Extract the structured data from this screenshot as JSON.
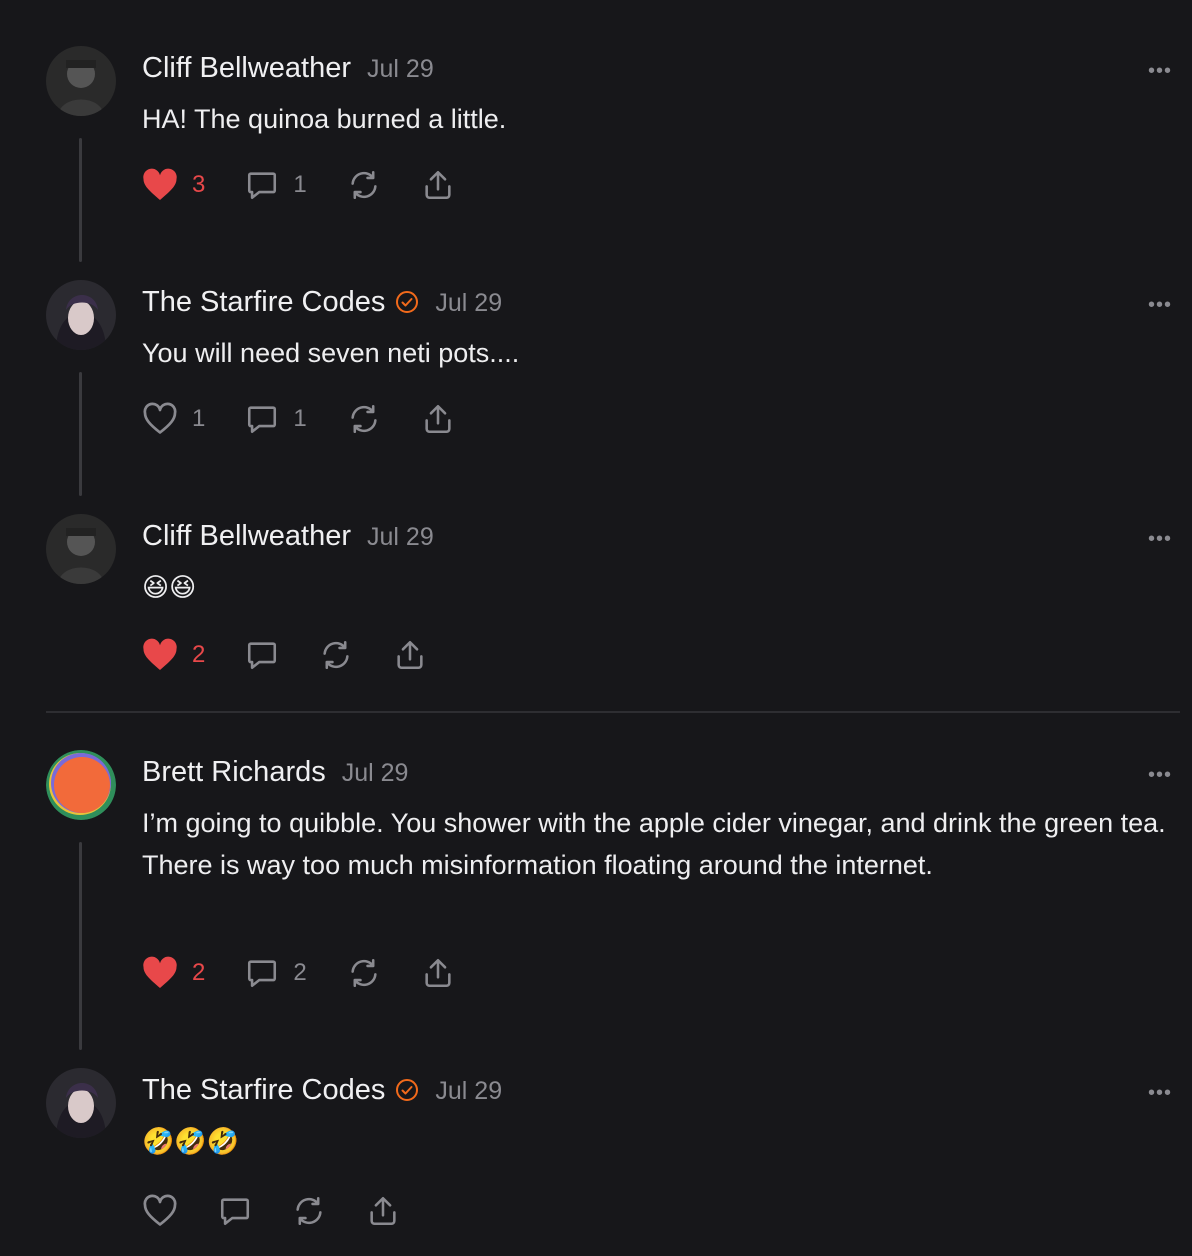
{
  "posts": [
    {
      "author": "Cliff Bellweather",
      "verified": false,
      "date": "Jul 29",
      "text": "HA! The quinoa burned a little.",
      "likes": "3",
      "liked": true,
      "replies": "1",
      "avatar": "cliff-avatar"
    },
    {
      "author": "The Starfire Codes",
      "verified": true,
      "date": "Jul 29",
      "text": "You will need seven neti pots....",
      "likes": "1",
      "liked": false,
      "replies": "1",
      "avatar": "starfire-avatar"
    },
    {
      "author": "Cliff Bellweather",
      "verified": false,
      "date": "Jul 29",
      "text": "😆😆",
      "likes": "2",
      "liked": true,
      "replies": "",
      "avatar": "cliff-avatar"
    },
    {
      "author": "Brett Richards",
      "verified": false,
      "date": "Jul 29",
      "text": "I’m going to quibble. You shower with the apple cider vinegar, and drink the green tea. There is way too much misinformation floating around the internet.",
      "likes": "2",
      "liked": true,
      "replies": "2",
      "avatar": "brett-avatar"
    },
    {
      "author": "The Starfire Codes",
      "verified": true,
      "date": "Jul 29",
      "text": "🤣🤣🤣",
      "likes": "",
      "liked": false,
      "replies": "",
      "avatar": "starfire-avatar"
    }
  ],
  "more_label": "•••",
  "colors": {
    "background": "#17171a",
    "like_red": "#e8484a",
    "verified_orange": "#f26a1b",
    "muted": "#8a8a90"
  }
}
